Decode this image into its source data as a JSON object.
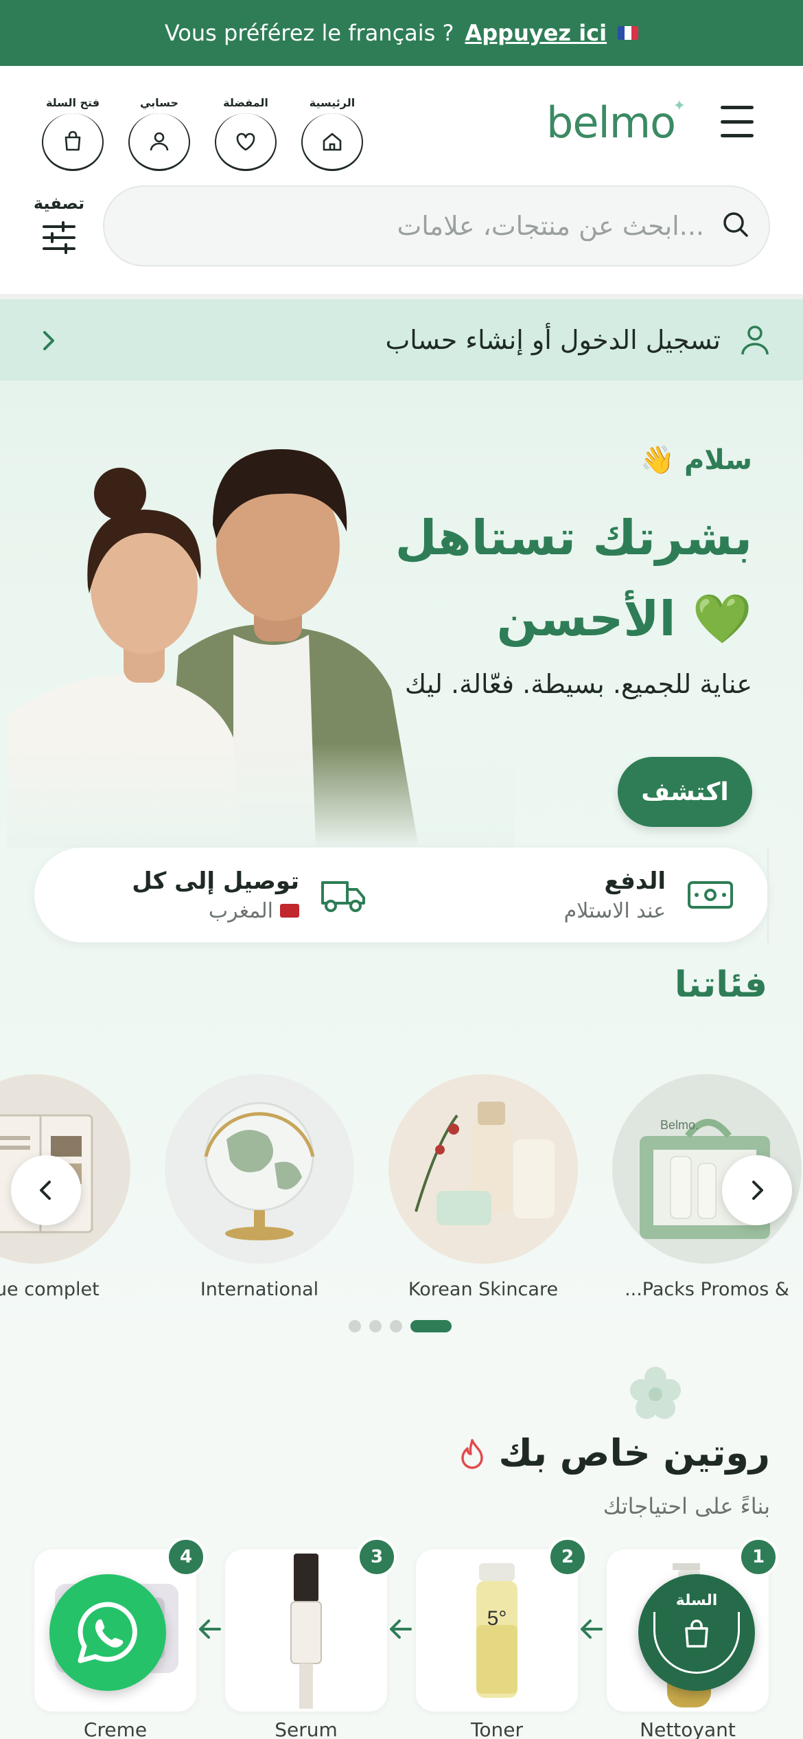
{
  "banner": {
    "text": "Vous préférez le français ?",
    "link": "Appuyez ici"
  },
  "header": {
    "brand": "belmo",
    "nav": [
      {
        "label": "فتح السلة",
        "icon": "bag-icon"
      },
      {
        "label": "حسابي",
        "icon": "user-icon"
      },
      {
        "label": "المفضلة",
        "icon": "heart-icon"
      },
      {
        "label": "الرئيسية",
        "icon": "home-icon"
      }
    ],
    "search_placeholder": "ابحث عن منتجات، علامات...",
    "filter_label": "تصفية"
  },
  "login": {
    "label": "تسجيل الدخول أو إنشاء حساب"
  },
  "hero": {
    "greeting": "سلام",
    "headline": "بشرتك تستاهل الأحسن",
    "subtitle": "عناية للجميع. بسيطة. فعّالة. ليك",
    "cta": "اكتشف",
    "perks": [
      {
        "title": "توصيل إلى كل",
        "subtitle": "المغرب",
        "icon": "truck-icon"
      },
      {
        "title": "الدفع",
        "subtitle": "عند الاستلام",
        "icon": "cash-icon"
      }
    ]
  },
  "categories": {
    "title": "فئاتنا",
    "items": [
      {
        "label": "...Packs Promos &"
      },
      {
        "label": "Korean Skincare"
      },
      {
        "label": "International"
      },
      {
        "label": "ogue complet"
      }
    ],
    "active_page": 4,
    "page_count": 4
  },
  "routine": {
    "title": "روتين خاص بك",
    "subtitle": "بناءً على احتياجاتك",
    "steps": [
      {
        "number": "1",
        "name": "Nettoyant"
      },
      {
        "number": "2",
        "name": "Toner"
      },
      {
        "number": "3",
        "name": "Serum"
      },
      {
        "number": "4",
        "name": "Creme"
      }
    ]
  },
  "floating": {
    "cart_label": "السلة"
  },
  "colors": {
    "brand": "#2e7d56",
    "banner": "#2e7d56",
    "whatsapp": "#25c26a",
    "accent_pink": "#e88aa8"
  }
}
